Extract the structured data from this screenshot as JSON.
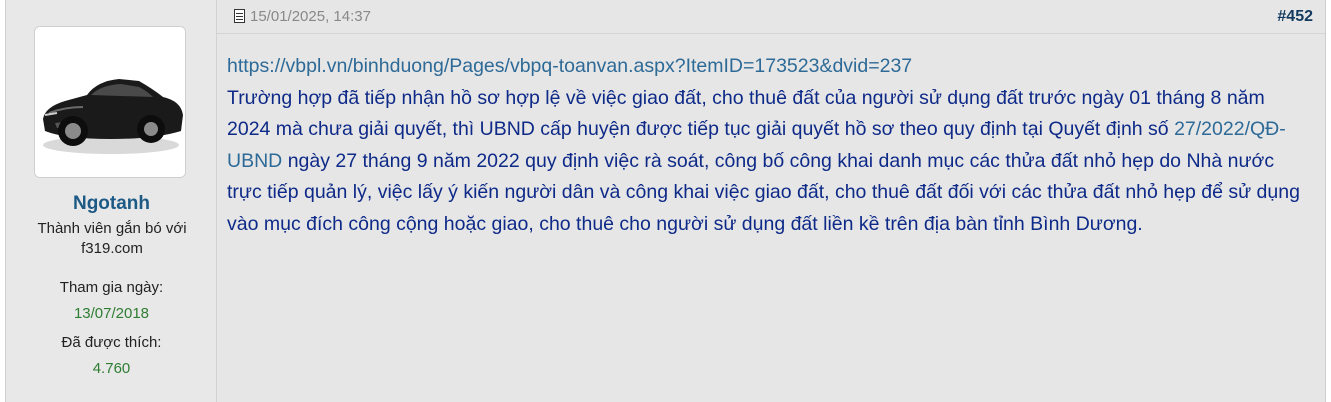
{
  "user": {
    "name": "Ngotanh",
    "title": "Thành viên gắn bó với f319.com",
    "join_label": "Tham gia ngày:",
    "join_date": "13/07/2018",
    "likes_label": "Đã được thích:",
    "likes_count": "4.760",
    "avatar_icon": "car-avatar-image"
  },
  "post": {
    "date": "15/01/2025, 14:37",
    "number": "#452",
    "link": "https://vbpl.vn/binhduong/Pages/vbpq-toanvan.aspx?ItemID=173523&dvid=237",
    "text_before": "Trường hợp đã tiếp nhận hồ sơ hợp lệ về việc giao đất, cho thuê đất của người sử dụng đất trước ngày 01 tháng 8 năm 2024 mà chưa giải quyết, thì UBND cấp huyện được tiếp tục giải quyết hồ sơ theo quy định tại Quyết định số",
    "decision_link": "27/2022/QĐ-UBND",
    "text_after": "ngày 27 tháng 9 năm 2022 quy định việc rà soát, công bố công khai danh mục các thửa đất nhỏ hẹp do Nhà nước trực tiếp quản lý, việc lấy ý kiến người dân và công khai việc giao đất, cho thuê đất đối với các thửa đất nhỏ hẹp để sử dụng vào mục đích công cộng hoặc giao, cho thuê cho người sử dụng đất liền kề trên địa bàn tỉnh Bình Dương."
  }
}
